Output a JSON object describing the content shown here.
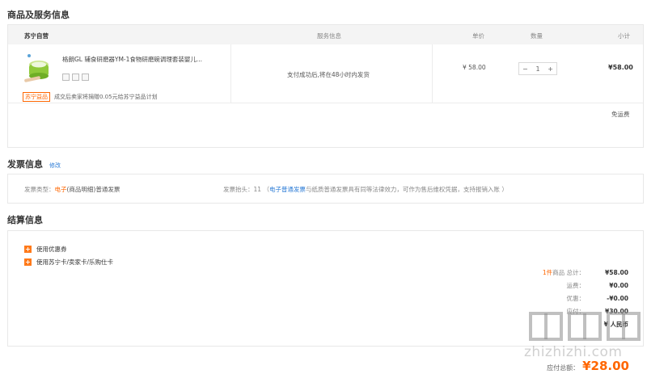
{
  "goods_section": {
    "title": "商品及服务信息",
    "columns": {
      "store": "苏宁自营",
      "service": "服务信息",
      "unit_price": "单价",
      "quantity": "数量",
      "subtotal": "小计"
    },
    "item": {
      "name": "格朗GL 辅食研磨器YM-1食物研磨碗调理套装婴儿...",
      "service_text": "支付成功后,将在48小时内发货",
      "unit_price": "¥ 58.00",
      "qty": "1",
      "qty_minus": "−",
      "qty_plus": "+",
      "subtotal": "¥58.00",
      "charity_tag": "苏宁益品",
      "charity_text": "成交后卖家将捐赠0.05元给苏宁益品计划"
    },
    "shipping_note": "免运费"
  },
  "invoice_section": {
    "title": "发票信息",
    "edit_link": "修改",
    "type_label": "发票类型：",
    "type_value_highlight": "电子",
    "type_value_rest": "(商品明细)普通发票",
    "header_label": "发票抬头：11",
    "note_open": "（",
    "note_link": "电子普通发票",
    "note_rest": "与纸质普通发票具有同等法律效力，可作为售后维权凭据，支持报销入账 ）"
  },
  "settlement_section": {
    "title": "结算信息",
    "options": [
      {
        "label": "使用优惠券"
      },
      {
        "label": "使用苏宁卡/卖家卡/乐购仕卡"
      }
    ],
    "summary": {
      "count_highlight": "1件",
      "count_label": "商品 总计：",
      "goods_total": "¥58.00",
      "freight_label": "运费：",
      "freight": "¥0.00",
      "discount_label": "优惠：",
      "discount": "-¥0.00",
      "row4_label": "应付：",
      "row4_value": "¥30.00",
      "row5_value": "¥ 人民币"
    },
    "pay_label": "应付总额：",
    "pay_amount": "¥28.00"
  },
  "watermark": {
    "logo_text": "值值值",
    "site_text": "zhizhizhi.com"
  },
  "colors": {
    "accent_orange": "#ff6600",
    "link_blue": "#2b7bd6",
    "header_bg": "#f4f4f4",
    "border": "#e8e8e8"
  }
}
